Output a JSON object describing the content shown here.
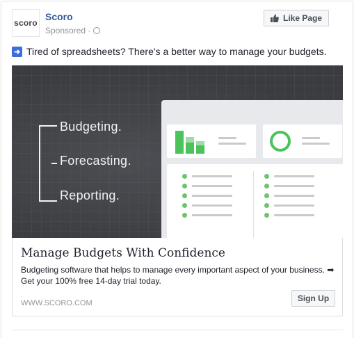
{
  "page": {
    "name": "Scoro",
    "logo_text": "scoro",
    "sponsored_label": "Sponsored · ",
    "like_button_label": "Like Page"
  },
  "post": {
    "text": "Tired of spreadsheets? There's a better way to manage your budgets."
  },
  "media": {
    "words": [
      "Budgeting.",
      "Forecasting.",
      "Reporting."
    ],
    "accent_color": "#4cc25b"
  },
  "link_card": {
    "headline": "Manage Budgets With Confidence",
    "description": "Budgeting software that helps to manage every important aspect of your business. ➡ Get your 100% free 14-day trial today.",
    "domain": "WWW.SCORO.COM",
    "cta_label": "Sign Up"
  }
}
